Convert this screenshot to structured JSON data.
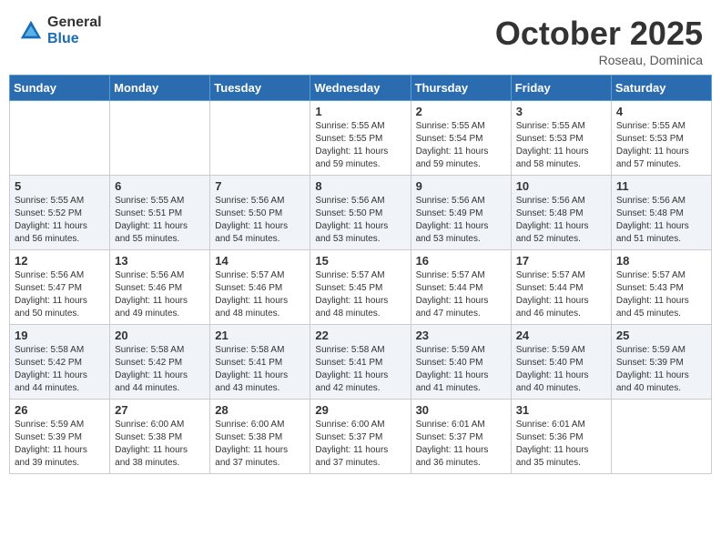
{
  "header": {
    "logo": {
      "general": "General",
      "blue": "Blue"
    },
    "title": "October 2025",
    "location": "Roseau, Dominica"
  },
  "weekdays": [
    "Sunday",
    "Monday",
    "Tuesday",
    "Wednesday",
    "Thursday",
    "Friday",
    "Saturday"
  ],
  "weeks": [
    [
      {
        "day": "",
        "info": ""
      },
      {
        "day": "",
        "info": ""
      },
      {
        "day": "",
        "info": ""
      },
      {
        "day": "1",
        "info": "Sunrise: 5:55 AM\nSunset: 5:55 PM\nDaylight: 11 hours\nand 59 minutes."
      },
      {
        "day": "2",
        "info": "Sunrise: 5:55 AM\nSunset: 5:54 PM\nDaylight: 11 hours\nand 59 minutes."
      },
      {
        "day": "3",
        "info": "Sunrise: 5:55 AM\nSunset: 5:53 PM\nDaylight: 11 hours\nand 58 minutes."
      },
      {
        "day": "4",
        "info": "Sunrise: 5:55 AM\nSunset: 5:53 PM\nDaylight: 11 hours\nand 57 minutes."
      }
    ],
    [
      {
        "day": "5",
        "info": "Sunrise: 5:55 AM\nSunset: 5:52 PM\nDaylight: 11 hours\nand 56 minutes."
      },
      {
        "day": "6",
        "info": "Sunrise: 5:55 AM\nSunset: 5:51 PM\nDaylight: 11 hours\nand 55 minutes."
      },
      {
        "day": "7",
        "info": "Sunrise: 5:56 AM\nSunset: 5:50 PM\nDaylight: 11 hours\nand 54 minutes."
      },
      {
        "day": "8",
        "info": "Sunrise: 5:56 AM\nSunset: 5:50 PM\nDaylight: 11 hours\nand 53 minutes."
      },
      {
        "day": "9",
        "info": "Sunrise: 5:56 AM\nSunset: 5:49 PM\nDaylight: 11 hours\nand 53 minutes."
      },
      {
        "day": "10",
        "info": "Sunrise: 5:56 AM\nSunset: 5:48 PM\nDaylight: 11 hours\nand 52 minutes."
      },
      {
        "day": "11",
        "info": "Sunrise: 5:56 AM\nSunset: 5:48 PM\nDaylight: 11 hours\nand 51 minutes."
      }
    ],
    [
      {
        "day": "12",
        "info": "Sunrise: 5:56 AM\nSunset: 5:47 PM\nDaylight: 11 hours\nand 50 minutes."
      },
      {
        "day": "13",
        "info": "Sunrise: 5:56 AM\nSunset: 5:46 PM\nDaylight: 11 hours\nand 49 minutes."
      },
      {
        "day": "14",
        "info": "Sunrise: 5:57 AM\nSunset: 5:46 PM\nDaylight: 11 hours\nand 48 minutes."
      },
      {
        "day": "15",
        "info": "Sunrise: 5:57 AM\nSunset: 5:45 PM\nDaylight: 11 hours\nand 48 minutes."
      },
      {
        "day": "16",
        "info": "Sunrise: 5:57 AM\nSunset: 5:44 PM\nDaylight: 11 hours\nand 47 minutes."
      },
      {
        "day": "17",
        "info": "Sunrise: 5:57 AM\nSunset: 5:44 PM\nDaylight: 11 hours\nand 46 minutes."
      },
      {
        "day": "18",
        "info": "Sunrise: 5:57 AM\nSunset: 5:43 PM\nDaylight: 11 hours\nand 45 minutes."
      }
    ],
    [
      {
        "day": "19",
        "info": "Sunrise: 5:58 AM\nSunset: 5:42 PM\nDaylight: 11 hours\nand 44 minutes."
      },
      {
        "day": "20",
        "info": "Sunrise: 5:58 AM\nSunset: 5:42 PM\nDaylight: 11 hours\nand 44 minutes."
      },
      {
        "day": "21",
        "info": "Sunrise: 5:58 AM\nSunset: 5:41 PM\nDaylight: 11 hours\nand 43 minutes."
      },
      {
        "day": "22",
        "info": "Sunrise: 5:58 AM\nSunset: 5:41 PM\nDaylight: 11 hours\nand 42 minutes."
      },
      {
        "day": "23",
        "info": "Sunrise: 5:59 AM\nSunset: 5:40 PM\nDaylight: 11 hours\nand 41 minutes."
      },
      {
        "day": "24",
        "info": "Sunrise: 5:59 AM\nSunset: 5:40 PM\nDaylight: 11 hours\nand 40 minutes."
      },
      {
        "day": "25",
        "info": "Sunrise: 5:59 AM\nSunset: 5:39 PM\nDaylight: 11 hours\nand 40 minutes."
      }
    ],
    [
      {
        "day": "26",
        "info": "Sunrise: 5:59 AM\nSunset: 5:39 PM\nDaylight: 11 hours\nand 39 minutes."
      },
      {
        "day": "27",
        "info": "Sunrise: 6:00 AM\nSunset: 5:38 PM\nDaylight: 11 hours\nand 38 minutes."
      },
      {
        "day": "28",
        "info": "Sunrise: 6:00 AM\nSunset: 5:38 PM\nDaylight: 11 hours\nand 37 minutes."
      },
      {
        "day": "29",
        "info": "Sunrise: 6:00 AM\nSunset: 5:37 PM\nDaylight: 11 hours\nand 37 minutes."
      },
      {
        "day": "30",
        "info": "Sunrise: 6:01 AM\nSunset: 5:37 PM\nDaylight: 11 hours\nand 36 minutes."
      },
      {
        "day": "31",
        "info": "Sunrise: 6:01 AM\nSunset: 5:36 PM\nDaylight: 11 hours\nand 35 minutes."
      },
      {
        "day": "",
        "info": ""
      }
    ]
  ]
}
